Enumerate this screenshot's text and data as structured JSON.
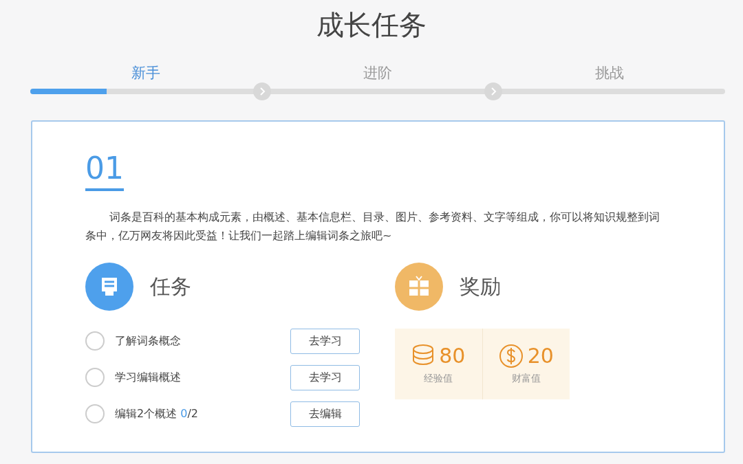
{
  "title": "成长任务",
  "steps": [
    {
      "label": "新手",
      "selected": true
    },
    {
      "label": "进阶",
      "selected": false
    },
    {
      "label": "挑战",
      "selected": false
    }
  ],
  "progress": {
    "level": 0.11
  },
  "stage": {
    "number": "01",
    "description": "词条是百科的基本构成元素，由概述、基本信息栏、目录、图片、参考资料、文字等组成，你可以将知识规整到词条中，亿万网友将因此受益！让我们一起踏上编辑词条之旅吧~"
  },
  "tasks": {
    "heading": "任务",
    "items": [
      {
        "label": "了解词条概念",
        "checked": false,
        "action": "去学习"
      },
      {
        "label": "学习编辑概述",
        "checked": false,
        "action": "去学习"
      },
      {
        "label": "编辑2个概述",
        "checked": false,
        "progress_done": "0",
        "progress_rest": "/2",
        "action": "去编辑"
      }
    ]
  },
  "rewards": {
    "heading": "奖励",
    "items": [
      {
        "kind": "coins",
        "value": "80",
        "label": "经验值"
      },
      {
        "kind": "dollar",
        "value": "20",
        "label": "财富值"
      }
    ]
  }
}
